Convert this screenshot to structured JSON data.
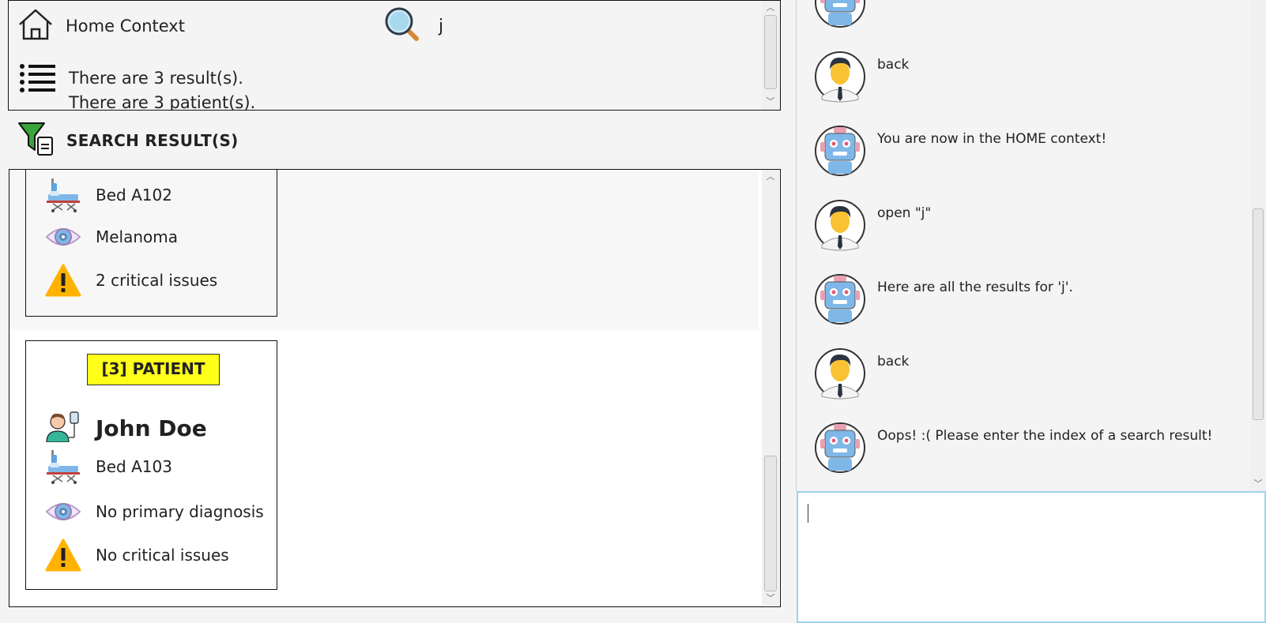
{
  "status": {
    "home_label": "Home Context",
    "search_value": "j",
    "results_text": "There are 3 result(s).",
    "patients_text": "There are 3 patient(s)."
  },
  "results": {
    "title": "SEARCH RESULT(S)",
    "card2": {
      "bed": "Bed A102",
      "diagnosis": "Melanoma",
      "issues": "2 critical issues"
    },
    "card3": {
      "badge": "[3] PATIENT",
      "name": "John Doe",
      "bed": "Bed A103",
      "diagnosis": "No primary diagnosis",
      "issues": "No critical issues"
    }
  },
  "chat": {
    "messages": [
      {
        "sender": "user",
        "text": "back"
      },
      {
        "sender": "bot",
        "text": "You are now in the HOME context!"
      },
      {
        "sender": "user",
        "text": "open \"j\""
      },
      {
        "sender": "bot",
        "text": "Here are all the results for 'j'."
      },
      {
        "sender": "user",
        "text": "back"
      },
      {
        "sender": "bot",
        "text": "Oops! :( Please enter the index of a search result!"
      }
    ],
    "input_value": ""
  },
  "icons": {
    "home": "home-icon",
    "search": "search-icon",
    "list": "list-icon",
    "filter": "filter-icon",
    "bed": "hospital-bed-icon",
    "eye": "eye-icon",
    "warning": "warning-icon",
    "patient": "patient-icon",
    "robot": "robot-avatar-icon",
    "user": "user-avatar-icon"
  },
  "colors": {
    "badge": "#ffff1a",
    "warning": "#ffb300",
    "input_border": "#9ed3ef"
  }
}
